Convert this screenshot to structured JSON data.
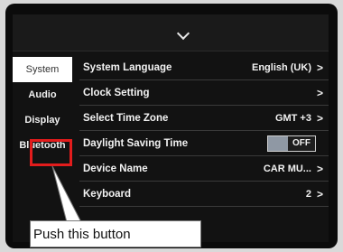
{
  "header": {
    "icon": "chevron-down-icon"
  },
  "sidebar": {
    "items": [
      {
        "label": "System",
        "active": true
      },
      {
        "label": "Audio"
      },
      {
        "label": "Display"
      },
      {
        "label": "Bluetooth",
        "highlighted": true
      }
    ]
  },
  "settings": {
    "rows": [
      {
        "label": "System Language",
        "value": "English (UK)",
        "arrow": ">"
      },
      {
        "label": "Clock Setting",
        "value": "",
        "arrow": ">"
      },
      {
        "label": "Select Time Zone",
        "value": "GMT +3",
        "arrow": ">"
      },
      {
        "label": "Daylight Saving Time",
        "toggle": "OFF"
      },
      {
        "label": "Device Name",
        "value": "CAR MU...",
        "arrow": ">"
      },
      {
        "label": "Keyboard",
        "value": "2",
        "arrow": ">"
      }
    ]
  },
  "annotation": {
    "text": "Push this button",
    "highlight_color": "#e21c1c"
  }
}
